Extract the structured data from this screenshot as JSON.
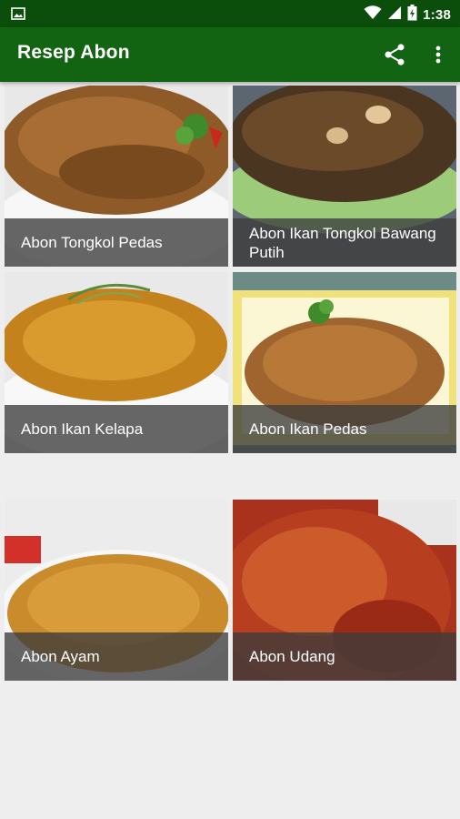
{
  "status_bar": {
    "time": "1:38",
    "icons": [
      "gallery-icon",
      "wifi-icon",
      "signal-icon",
      "battery-charging-icon"
    ]
  },
  "app_bar": {
    "title": "Resep Abon",
    "actions": [
      "share-icon",
      "more-vert-icon"
    ]
  },
  "recipes": [
    {
      "name": "Abon Tongkol Pedas"
    },
    {
      "name": "Abon Ikan Tongkol Bawang Putih"
    },
    {
      "name": "Abon Ikan Kelapa"
    },
    {
      "name": "Abon Ikan Pedas"
    },
    {
      "name": "Abon Ayam"
    },
    {
      "name": "Abon Udang"
    }
  ],
  "colors": {
    "status_bar": "#0b4d0b",
    "app_bar": "#126312",
    "background": "#eeeeee",
    "caption_overlay": "#3c3c3c"
  }
}
